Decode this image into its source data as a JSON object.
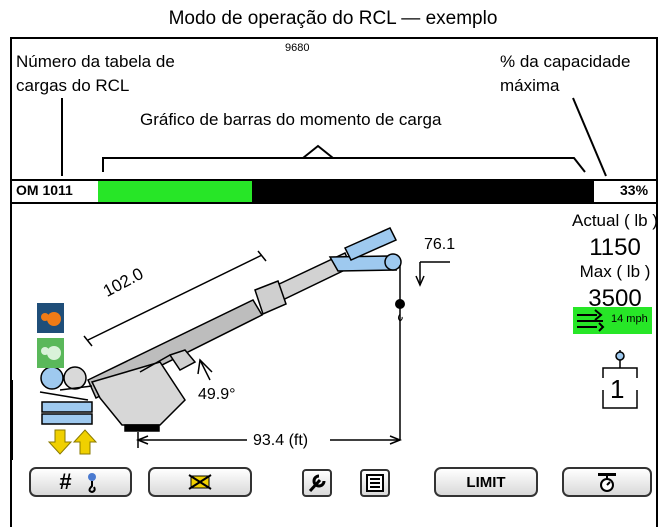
{
  "page_title": "Modo de operação do RCL — exemplo",
  "doc_number": "9680",
  "annotations": {
    "load_chart_number": "Número da tabela de cargas do RCL",
    "max_capacity_pct": "% da capacidade máxima",
    "load_moment_bar_graph": "Gráfico de barras do momento de carga"
  },
  "status": {
    "chart_code": "OM 1011",
    "capacity_percent": "33%",
    "load_moment_fraction": 0.31
  },
  "readings": {
    "actual_label": "Actual ( lb )",
    "actual_value": "1150",
    "max_label": "Max ( lb )",
    "max_value": "3500",
    "wind_speed": "14 mph",
    "parts_of_line": "1"
  },
  "boom": {
    "length": "102.0",
    "angle": "49.9°",
    "radius": "93.4 (ft)",
    "tip_height": "76.1"
  },
  "buttons": {
    "limit_label": "LIMIT"
  },
  "colors": {
    "bar_fill": "#27e627",
    "wind_bg": "#27e627",
    "boom_fill": "#9ec9ef"
  }
}
